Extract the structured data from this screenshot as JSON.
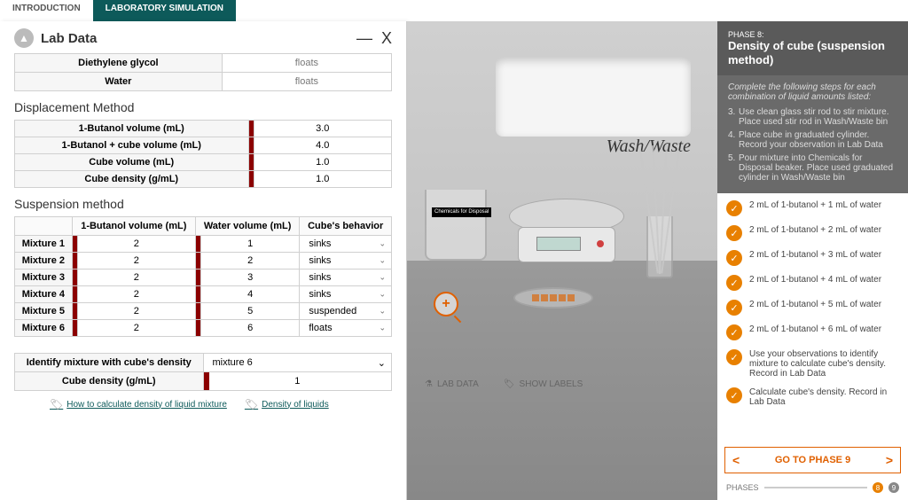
{
  "tabs": {
    "intro": "INTRODUCTION",
    "sim": "LABORATORY SIMULATION"
  },
  "panel": {
    "title": "Lab Data",
    "minimize": "—",
    "close": "X",
    "top_rows": [
      {
        "label": "Diethylene glycol",
        "value": "floats"
      },
      {
        "label": "Water",
        "value": "floats"
      }
    ],
    "displacement_title": "Displacement Method",
    "displacement_rows": [
      {
        "label": "1-Butanol volume (mL)",
        "value": "3.0"
      },
      {
        "label": "1-Butanol + cube volume (mL)",
        "value": "4.0"
      },
      {
        "label": "Cube volume (mL)",
        "value": "1.0"
      },
      {
        "label": "Cube density (g/mL)",
        "value": "1.0"
      }
    ],
    "suspension_title": "Suspension method",
    "susp_headers": {
      "blank": "",
      "butanol": "1-Butanol volume (mL)",
      "water": "Water volume (mL)",
      "behavior": "Cube's behavior"
    },
    "susp_rows": [
      {
        "label": "Mixture 1",
        "butanol": "2",
        "water": "1",
        "behavior": "sinks"
      },
      {
        "label": "Mixture 2",
        "butanol": "2",
        "water": "2",
        "behavior": "sinks"
      },
      {
        "label": "Mixture 3",
        "butanol": "2",
        "water": "3",
        "behavior": "sinks"
      },
      {
        "label": "Mixture 4",
        "butanol": "2",
        "water": "4",
        "behavior": "sinks"
      },
      {
        "label": "Mixture 5",
        "butanol": "2",
        "water": "5",
        "behavior": "suspended"
      },
      {
        "label": "Mixture 6",
        "butanol": "2",
        "water": "6",
        "behavior": "floats"
      }
    ],
    "identify_label": "Identify mixture with cube's density",
    "identify_value": "mixture 6",
    "density_label": "Cube density (g/mL)",
    "density_value": "1",
    "link1": "How to calculate density of liquid mixture",
    "link2": "Density of liquids"
  },
  "sim": {
    "wash_label": "Wash/Waste",
    "beaker_label": "Chemicals for Disposal",
    "footer_labdata": "LAB DATA",
    "footer_labels": "SHOW LABELS",
    "zoom": "+"
  },
  "side": {
    "phase_label": "PHASE 8:",
    "phase_title": "Density of cube (suspension method)",
    "instr_lead": "Complete the following steps for each combination of liquid amounts listed:",
    "steps": [
      {
        "n": "3.",
        "t": "Use clean glass stir rod to stir mixture. Place used stir rod in Wash/Waste bin"
      },
      {
        "n": "4.",
        "t": "Place cube in graduated cylinder. Record your observation in Lab Data"
      },
      {
        "n": "5.",
        "t": "Pour mixture into Chemicals for Disposal beaker. Place used graduated cylinder in Wash/Waste bin"
      }
    ],
    "checks": [
      "2 mL of 1-butanol + 1 mL of water",
      "2 mL of 1-butanol + 2 mL of water",
      "2 mL of 1-butanol + 3 mL of water",
      "2 mL of 1-butanol + 4 mL of water",
      "2 mL of 1-butanol + 5 mL of water",
      "2 mL of 1-butanol + 6 mL of water",
      "Use your observations to identify mixture to calculate cube's density. Record in Lab Data",
      "Calculate cube's density. Record in Lab Data"
    ],
    "go_label": "GO TO PHASE 9",
    "phases_label": "PHASES",
    "cur_phase": "8",
    "next_phase": "9"
  }
}
